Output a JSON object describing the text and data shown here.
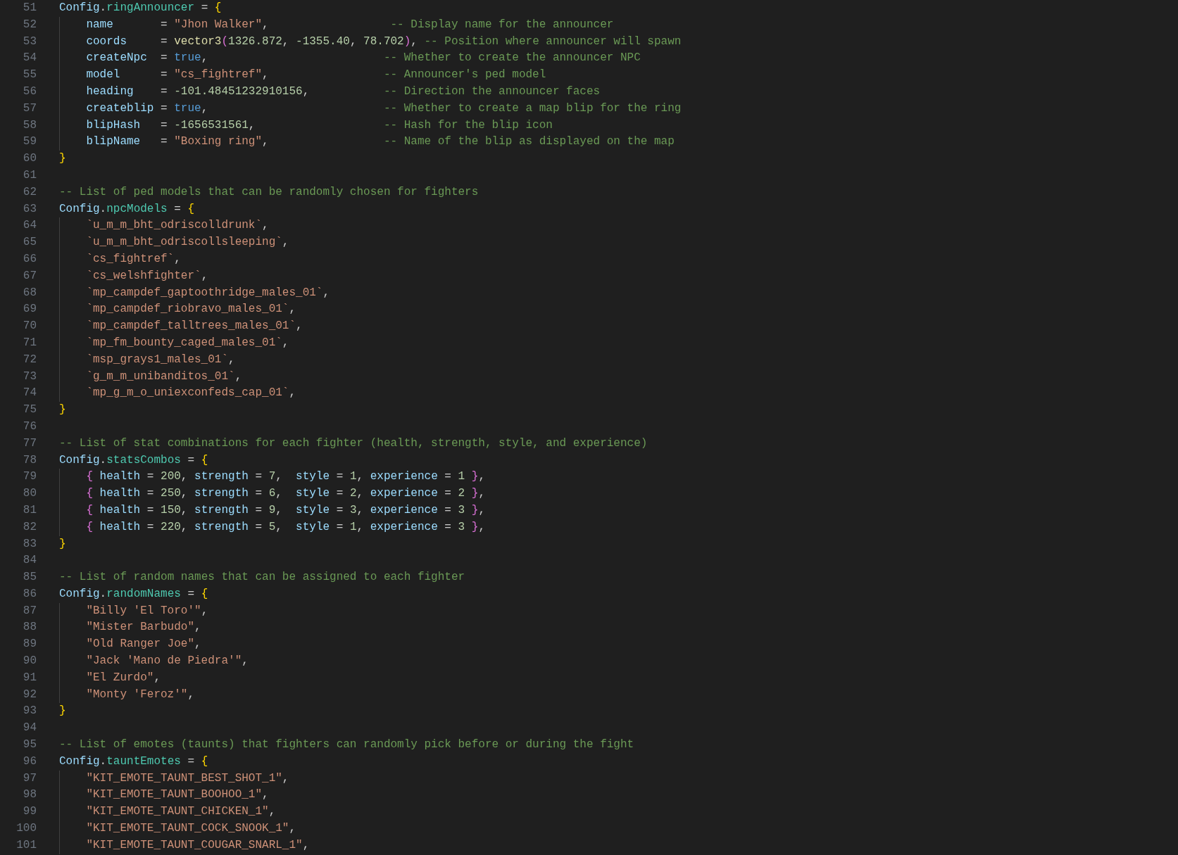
{
  "editor": {
    "lines": [
      {
        "number": "51",
        "indent": false,
        "tokens": [
          {
            "kind": "var",
            "text": "Config"
          },
          {
            "kind": "plain",
            "text": "."
          },
          {
            "kind": "field",
            "text": "ringAnnouncer"
          },
          {
            "kind": "plain",
            "text": " = "
          },
          {
            "kind": "b1",
            "text": "{"
          }
        ]
      },
      {
        "number": "52",
        "indent": true,
        "tokens": [
          {
            "kind": "var",
            "text": "name"
          },
          {
            "kind": "plain",
            "text": "       = "
          },
          {
            "kind": "str",
            "text": "\"Jhon Walker\""
          },
          {
            "kind": "plain",
            "text": ",                  "
          },
          {
            "kind": "comment",
            "text": "-- Display name for the announcer"
          }
        ]
      },
      {
        "number": "53",
        "indent": true,
        "tokens": [
          {
            "kind": "var",
            "text": "coords"
          },
          {
            "kind": "plain",
            "text": "     = "
          },
          {
            "kind": "fn",
            "text": "vector3"
          },
          {
            "kind": "b2",
            "text": "("
          },
          {
            "kind": "num",
            "text": "1326.872"
          },
          {
            "kind": "plain",
            "text": ", "
          },
          {
            "kind": "num",
            "text": "-1355.40"
          },
          {
            "kind": "plain",
            "text": ", "
          },
          {
            "kind": "num",
            "text": "78.702"
          },
          {
            "kind": "b2",
            "text": ")"
          },
          {
            "kind": "plain",
            "text": ", "
          },
          {
            "kind": "comment",
            "text": "-- Position where announcer will spawn"
          }
        ]
      },
      {
        "number": "54",
        "indent": true,
        "tokens": [
          {
            "kind": "var",
            "text": "createNpc"
          },
          {
            "kind": "plain",
            "text": "  = "
          },
          {
            "kind": "bool",
            "text": "true"
          },
          {
            "kind": "plain",
            "text": ",                          "
          },
          {
            "kind": "comment",
            "text": "-- Whether to create the announcer NPC"
          }
        ]
      },
      {
        "number": "55",
        "indent": true,
        "tokens": [
          {
            "kind": "var",
            "text": "model"
          },
          {
            "kind": "plain",
            "text": "      = "
          },
          {
            "kind": "str",
            "text": "\"cs_fightref\""
          },
          {
            "kind": "plain",
            "text": ",                 "
          },
          {
            "kind": "comment",
            "text": "-- Announcer's ped model"
          }
        ]
      },
      {
        "number": "56",
        "indent": true,
        "tokens": [
          {
            "kind": "var",
            "text": "heading"
          },
          {
            "kind": "plain",
            "text": "    = "
          },
          {
            "kind": "num",
            "text": "-101.48451232910156"
          },
          {
            "kind": "plain",
            "text": ",           "
          },
          {
            "kind": "comment",
            "text": "-- Direction the announcer faces"
          }
        ]
      },
      {
        "number": "57",
        "indent": true,
        "tokens": [
          {
            "kind": "var",
            "text": "createblip"
          },
          {
            "kind": "plain",
            "text": " = "
          },
          {
            "kind": "bool",
            "text": "true"
          },
          {
            "kind": "plain",
            "text": ",                          "
          },
          {
            "kind": "comment",
            "text": "-- Whether to create a map blip for the ring"
          }
        ]
      },
      {
        "number": "58",
        "indent": true,
        "tokens": [
          {
            "kind": "var",
            "text": "blipHash"
          },
          {
            "kind": "plain",
            "text": "   = "
          },
          {
            "kind": "num",
            "text": "-1656531561"
          },
          {
            "kind": "plain",
            "text": ",                   "
          },
          {
            "kind": "comment",
            "text": "-- Hash for the blip icon"
          }
        ]
      },
      {
        "number": "59",
        "indent": true,
        "tokens": [
          {
            "kind": "var",
            "text": "blipName"
          },
          {
            "kind": "plain",
            "text": "   = "
          },
          {
            "kind": "str",
            "text": "\"Boxing ring\""
          },
          {
            "kind": "plain",
            "text": ",                 "
          },
          {
            "kind": "comment",
            "text": "-- Name of the blip as displayed on the map"
          }
        ]
      },
      {
        "number": "60",
        "indent": false,
        "tokens": [
          {
            "kind": "b1",
            "text": "}"
          }
        ]
      },
      {
        "number": "61",
        "indent": false
      },
      {
        "number": "62",
        "indent": false,
        "tokens": [
          {
            "kind": "comment",
            "text": "-- List of ped models that can be randomly chosen for fighters"
          }
        ]
      },
      {
        "number": "63",
        "indent": false,
        "tokens": [
          {
            "kind": "var",
            "text": "Config"
          },
          {
            "kind": "plain",
            "text": "."
          },
          {
            "kind": "field",
            "text": "npcModels"
          },
          {
            "kind": "plain",
            "text": " = "
          },
          {
            "kind": "b1",
            "text": "{"
          }
        ]
      },
      {
        "number": "64",
        "indent": true,
        "tokens": [
          {
            "kind": "str",
            "text": "`u_m_m_bht_odriscolldrunk`"
          },
          {
            "kind": "plain",
            "text": ","
          }
        ]
      },
      {
        "number": "65",
        "indent": true,
        "tokens": [
          {
            "kind": "str",
            "text": "`u_m_m_bht_odriscollsleeping`"
          },
          {
            "kind": "plain",
            "text": ","
          }
        ]
      },
      {
        "number": "66",
        "indent": true,
        "tokens": [
          {
            "kind": "str",
            "text": "`cs_fightref`"
          },
          {
            "kind": "plain",
            "text": ","
          }
        ]
      },
      {
        "number": "67",
        "indent": true,
        "tokens": [
          {
            "kind": "str",
            "text": "`cs_welshfighter`"
          },
          {
            "kind": "plain",
            "text": ","
          }
        ]
      },
      {
        "number": "68",
        "indent": true,
        "tokens": [
          {
            "kind": "str",
            "text": "`mp_campdef_gaptoothridge_males_01`"
          },
          {
            "kind": "plain",
            "text": ","
          }
        ]
      },
      {
        "number": "69",
        "indent": true,
        "tokens": [
          {
            "kind": "str",
            "text": "`mp_campdef_riobravo_males_01`"
          },
          {
            "kind": "plain",
            "text": ","
          }
        ]
      },
      {
        "number": "70",
        "indent": true,
        "tokens": [
          {
            "kind": "str",
            "text": "`mp_campdef_talltrees_males_01`"
          },
          {
            "kind": "plain",
            "text": ","
          }
        ]
      },
      {
        "number": "71",
        "indent": true,
        "tokens": [
          {
            "kind": "str",
            "text": "`mp_fm_bounty_caged_males_01`"
          },
          {
            "kind": "plain",
            "text": ","
          }
        ]
      },
      {
        "number": "72",
        "indent": true,
        "tokens": [
          {
            "kind": "str",
            "text": "`msp_grays1_males_01`"
          },
          {
            "kind": "plain",
            "text": ","
          }
        ]
      },
      {
        "number": "73",
        "indent": true,
        "tokens": [
          {
            "kind": "str",
            "text": "`g_m_m_unibanditos_01`"
          },
          {
            "kind": "plain",
            "text": ","
          }
        ]
      },
      {
        "number": "74",
        "indent": true,
        "tokens": [
          {
            "kind": "str",
            "text": "`mp_g_m_o_uniexconfeds_cap_01`"
          },
          {
            "kind": "plain",
            "text": ","
          }
        ]
      },
      {
        "number": "75",
        "indent": false,
        "tokens": [
          {
            "kind": "b1",
            "text": "}"
          }
        ]
      },
      {
        "number": "76",
        "indent": false
      },
      {
        "number": "77",
        "indent": false,
        "tokens": [
          {
            "kind": "comment",
            "text": "-- List of stat combinations for each fighter (health, strength, style, and experience)"
          }
        ]
      },
      {
        "number": "78",
        "indent": false,
        "tokens": [
          {
            "kind": "var",
            "text": "Config"
          },
          {
            "kind": "plain",
            "text": "."
          },
          {
            "kind": "field",
            "text": "statsCombos"
          },
          {
            "kind": "plain",
            "text": " = "
          },
          {
            "kind": "b1",
            "text": "{"
          }
        ]
      },
      {
        "number": "79",
        "indent": true,
        "tokens": [
          {
            "kind": "b2",
            "text": "{"
          },
          {
            "kind": "var",
            "text": " health"
          },
          {
            "kind": "plain",
            "text": " = "
          },
          {
            "kind": "num",
            "text": "200"
          },
          {
            "kind": "plain",
            "text": ", "
          },
          {
            "kind": "var",
            "text": "strength"
          },
          {
            "kind": "plain",
            "text": " = "
          },
          {
            "kind": "num",
            "text": "7"
          },
          {
            "kind": "plain",
            "text": ",  "
          },
          {
            "kind": "var",
            "text": "style"
          },
          {
            "kind": "plain",
            "text": " = "
          },
          {
            "kind": "num",
            "text": "1"
          },
          {
            "kind": "plain",
            "text": ", "
          },
          {
            "kind": "var",
            "text": "experience"
          },
          {
            "kind": "plain",
            "text": " = "
          },
          {
            "kind": "num",
            "text": "1"
          },
          {
            "kind": "b2",
            "text": " }"
          },
          {
            "kind": "plain",
            "text": ","
          }
        ]
      },
      {
        "number": "80",
        "indent": true,
        "tokens": [
          {
            "kind": "b2",
            "text": "{"
          },
          {
            "kind": "var",
            "text": " health"
          },
          {
            "kind": "plain",
            "text": " = "
          },
          {
            "kind": "num",
            "text": "250"
          },
          {
            "kind": "plain",
            "text": ", "
          },
          {
            "kind": "var",
            "text": "strength"
          },
          {
            "kind": "plain",
            "text": " = "
          },
          {
            "kind": "num",
            "text": "6"
          },
          {
            "kind": "plain",
            "text": ",  "
          },
          {
            "kind": "var",
            "text": "style"
          },
          {
            "kind": "plain",
            "text": " = "
          },
          {
            "kind": "num",
            "text": "2"
          },
          {
            "kind": "plain",
            "text": ", "
          },
          {
            "kind": "var",
            "text": "experience"
          },
          {
            "kind": "plain",
            "text": " = "
          },
          {
            "kind": "num",
            "text": "2"
          },
          {
            "kind": "b2",
            "text": " }"
          },
          {
            "kind": "plain",
            "text": ","
          }
        ]
      },
      {
        "number": "81",
        "indent": true,
        "tokens": [
          {
            "kind": "b2",
            "text": "{"
          },
          {
            "kind": "var",
            "text": " health"
          },
          {
            "kind": "plain",
            "text": " = "
          },
          {
            "kind": "num",
            "text": "150"
          },
          {
            "kind": "plain",
            "text": ", "
          },
          {
            "kind": "var",
            "text": "strength"
          },
          {
            "kind": "plain",
            "text": " = "
          },
          {
            "kind": "num",
            "text": "9"
          },
          {
            "kind": "plain",
            "text": ",  "
          },
          {
            "kind": "var",
            "text": "style"
          },
          {
            "kind": "plain",
            "text": " = "
          },
          {
            "kind": "num",
            "text": "3"
          },
          {
            "kind": "plain",
            "text": ", "
          },
          {
            "kind": "var",
            "text": "experience"
          },
          {
            "kind": "plain",
            "text": " = "
          },
          {
            "kind": "num",
            "text": "3"
          },
          {
            "kind": "b2",
            "text": " }"
          },
          {
            "kind": "plain",
            "text": ","
          }
        ]
      },
      {
        "number": "82",
        "indent": true,
        "tokens": [
          {
            "kind": "b2",
            "text": "{"
          },
          {
            "kind": "var",
            "text": " health"
          },
          {
            "kind": "plain",
            "text": " = "
          },
          {
            "kind": "num",
            "text": "220"
          },
          {
            "kind": "plain",
            "text": ", "
          },
          {
            "kind": "var",
            "text": "strength"
          },
          {
            "kind": "plain",
            "text": " = "
          },
          {
            "kind": "num",
            "text": "5"
          },
          {
            "kind": "plain",
            "text": ",  "
          },
          {
            "kind": "var",
            "text": "style"
          },
          {
            "kind": "plain",
            "text": " = "
          },
          {
            "kind": "num",
            "text": "1"
          },
          {
            "kind": "plain",
            "text": ", "
          },
          {
            "kind": "var",
            "text": "experience"
          },
          {
            "kind": "plain",
            "text": " = "
          },
          {
            "kind": "num",
            "text": "3"
          },
          {
            "kind": "b2",
            "text": " }"
          },
          {
            "kind": "plain",
            "text": ","
          }
        ]
      },
      {
        "number": "83",
        "indent": false,
        "tokens": [
          {
            "kind": "b1",
            "text": "}"
          }
        ]
      },
      {
        "number": "84",
        "indent": false
      },
      {
        "number": "85",
        "indent": false,
        "tokens": [
          {
            "kind": "comment",
            "text": "-- List of random names that can be assigned to each fighter"
          }
        ]
      },
      {
        "number": "86",
        "indent": false,
        "tokens": [
          {
            "kind": "var",
            "text": "Config"
          },
          {
            "kind": "plain",
            "text": "."
          },
          {
            "kind": "field",
            "text": "randomNames"
          },
          {
            "kind": "plain",
            "text": " = "
          },
          {
            "kind": "b1",
            "text": "{"
          }
        ]
      },
      {
        "number": "87",
        "indent": true,
        "tokens": [
          {
            "kind": "str",
            "text": "\"Billy 'El Toro'\""
          },
          {
            "kind": "plain",
            "text": ","
          }
        ]
      },
      {
        "number": "88",
        "indent": true,
        "tokens": [
          {
            "kind": "str",
            "text": "\"Mister Barbudo\""
          },
          {
            "kind": "plain",
            "text": ","
          }
        ]
      },
      {
        "number": "89",
        "indent": true,
        "tokens": [
          {
            "kind": "str",
            "text": "\"Old Ranger Joe\""
          },
          {
            "kind": "plain",
            "text": ","
          }
        ]
      },
      {
        "number": "90",
        "indent": true,
        "tokens": [
          {
            "kind": "str",
            "text": "\"Jack 'Mano de Piedra'\""
          },
          {
            "kind": "plain",
            "text": ","
          }
        ]
      },
      {
        "number": "91",
        "indent": true,
        "tokens": [
          {
            "kind": "str",
            "text": "\"El Zurdo\""
          },
          {
            "kind": "plain",
            "text": ","
          }
        ]
      },
      {
        "number": "92",
        "indent": true,
        "tokens": [
          {
            "kind": "str",
            "text": "\"Monty 'Feroz'\""
          },
          {
            "kind": "plain",
            "text": ","
          }
        ]
      },
      {
        "number": "93",
        "indent": false,
        "tokens": [
          {
            "kind": "b1",
            "text": "}"
          }
        ]
      },
      {
        "number": "94",
        "indent": false
      },
      {
        "number": "95",
        "indent": false,
        "tokens": [
          {
            "kind": "comment",
            "text": "-- List of emotes (taunts) that fighters can randomly pick before or during the fight"
          }
        ]
      },
      {
        "number": "96",
        "indent": false,
        "tokens": [
          {
            "kind": "var",
            "text": "Config"
          },
          {
            "kind": "plain",
            "text": "."
          },
          {
            "kind": "field",
            "text": "tauntEmotes"
          },
          {
            "kind": "plain",
            "text": " = "
          },
          {
            "kind": "b1",
            "text": "{"
          }
        ]
      },
      {
        "number": "97",
        "indent": true,
        "tokens": [
          {
            "kind": "str",
            "text": "\"KIT_EMOTE_TAUNT_BEST_SHOT_1\""
          },
          {
            "kind": "plain",
            "text": ","
          }
        ]
      },
      {
        "number": "98",
        "indent": true,
        "tokens": [
          {
            "kind": "str",
            "text": "\"KIT_EMOTE_TAUNT_BOOHOO_1\""
          },
          {
            "kind": "plain",
            "text": ","
          }
        ]
      },
      {
        "number": "99",
        "indent": true,
        "tokens": [
          {
            "kind": "str",
            "text": "\"KIT_EMOTE_TAUNT_CHICKEN_1\""
          },
          {
            "kind": "plain",
            "text": ","
          }
        ]
      },
      {
        "number": "100",
        "indent": true,
        "tokens": [
          {
            "kind": "str",
            "text": "\"KIT_EMOTE_TAUNT_COCK_SNOOK_1\""
          },
          {
            "kind": "plain",
            "text": ","
          }
        ]
      },
      {
        "number": "101",
        "indent": true,
        "tokens": [
          {
            "kind": "str",
            "text": "\"KIT_EMOTE_TAUNT_COUGAR_SNARL_1\""
          },
          {
            "kind": "plain",
            "text": ","
          }
        ]
      }
    ]
  }
}
